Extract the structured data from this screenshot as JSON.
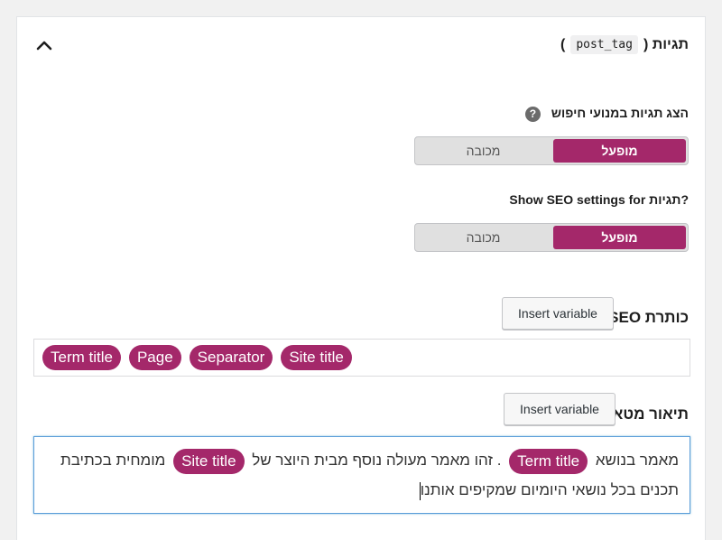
{
  "header": {
    "title": "תגיות (",
    "code": "post_tag",
    "close_paren": ")",
    "chevron_icon": "chevron-up-icon"
  },
  "setting1": {
    "label": "הצג תגיות במנועי חיפוש",
    "help_icon": "question-mark-icon",
    "help_glyph": "?",
    "on_label": "מופעל",
    "off_label": "מכובה",
    "selected": "on"
  },
  "setting2": {
    "label": "Show SEO settings for תגיות?",
    "on_label": "מופעל",
    "off_label": "מכובה",
    "selected": "on"
  },
  "seo_title": {
    "label": "כותרת SEO",
    "insert_button": "Insert variable",
    "pills": [
      "Term title",
      "Page",
      "Separator",
      "Site title"
    ]
  },
  "meta_desc": {
    "label": "תיאור מטא",
    "insert_button": "Insert variable",
    "text_1": "מאמר בנושא",
    "pill_1": "Term title",
    "text_2": ". זהו מאמר מעולה נוסף מבית היוצר של",
    "pill_2": "Site title",
    "text_3": "מומחית בכתיבת תכנים בכל נושאי היומיום שמקיפים אותנו"
  },
  "colors": {
    "accent": "#a4286a",
    "focus_border": "#5b9dd9",
    "background": "#f1f1f1"
  }
}
